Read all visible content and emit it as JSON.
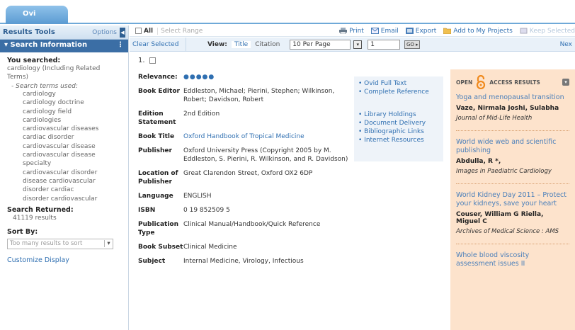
{
  "tab": {
    "label": "Ovi"
  },
  "left": {
    "tools_title": "Results Tools",
    "options_label": "Options",
    "search_info_title": "Search Information",
    "you_searched_label": "You searched:",
    "you_searched_value": "cardiology (Including Related Terms)",
    "terms_label": "- Search terms used:",
    "terms": [
      "cardiology",
      "cardiology doctrine",
      "cardiology field",
      "cardiologies",
      "cardiovascular diseases",
      "cardiac disorder",
      "cardiovascular disease",
      "cardiovascular disease specialty",
      "cardiovascular disorder",
      "disease cardiovascular",
      "disorder cardiac",
      "disorder cardiovascular"
    ],
    "returned_label": "Search Returned:",
    "returned_value": "41119 results",
    "sort_label": "Sort By:",
    "sort_placeholder": "Too many results to sort",
    "customize_label": "Customize Display"
  },
  "toolbar": {
    "all_label": "All",
    "select_range": "Select Range",
    "print": "Print",
    "email": "Email",
    "export": "Export",
    "add_projects": "Add to My Projects",
    "keep": "Keep Selected"
  },
  "subbar": {
    "clear_selected": "Clear Selected",
    "view_label": "View:",
    "view_title": "Title",
    "view_citation": "Citation",
    "per_page": "10 Per Page",
    "page": "1",
    "next": "Nex"
  },
  "record": {
    "number": "1.",
    "fields": [
      {
        "key": "Relevance:",
        "value": "●●●●●",
        "type": "stars"
      },
      {
        "key": "Book Editor",
        "value": "Eddleston, Michael; Pierini, Stephen; Wilkinson, Robert; Davidson, Robert",
        "type": "text"
      },
      {
        "key": "Edition Statement",
        "value": "2nd Edition",
        "type": "text"
      },
      {
        "key": "Book Title",
        "value": "Oxford Handbook of Tropical Medicine",
        "type": "link"
      },
      {
        "key": "Publisher",
        "value": "Oxford University Press (Copyright 2005 by M. Eddleston, S. Pierini, R. Wilkinson, and R. Davidson)",
        "type": "text"
      },
      {
        "key": "Location of Publisher",
        "value": "Great Clarendon Street, Oxford OX2 6DP",
        "type": "text"
      },
      {
        "key": "Language",
        "value": "ENGLISH",
        "type": "text"
      },
      {
        "key": "ISBN",
        "value": "0 19 852509 5",
        "type": "text"
      },
      {
        "key": "Publication Type",
        "value": "Clinical Manual/Handbook/Quick Reference",
        "type": "text"
      },
      {
        "key": "Book Subset",
        "value": "Clinical Medicine",
        "type": "text"
      },
      {
        "key": "Subject",
        "value": "Internal Medicine, Virology, Infectious",
        "type": "text"
      }
    ]
  },
  "links": {
    "group1": [
      "Ovid Full Text",
      "Complete Reference"
    ],
    "group2": [
      "Library Holdings",
      "Document Delivery",
      "Bibliographic Links",
      "Internet Resources"
    ]
  },
  "open_access": {
    "header_left": "OPEN",
    "header_right": "ACCESS RESULTS",
    "items": [
      {
        "title": "Yoga and menopausal transition",
        "authors": "Vaze, Nirmala Joshi, Sulabha",
        "journal": "Journal of Mid-Life Health"
      },
      {
        "title": "World wide web and scientific publishing",
        "authors": "Abdulla, R *,",
        "journal": "Images in Paediatric Cardiology"
      },
      {
        "title": "World Kidney Day 2011 – Protect your kidneys, save your heart",
        "authors": "Couser, William G Riella, Miguel C",
        "journal": "Archives of Medical Science : AMS"
      },
      {
        "title": "Whole blood viscosity assessment issues II",
        "authors": "",
        "journal": ""
      }
    ]
  }
}
